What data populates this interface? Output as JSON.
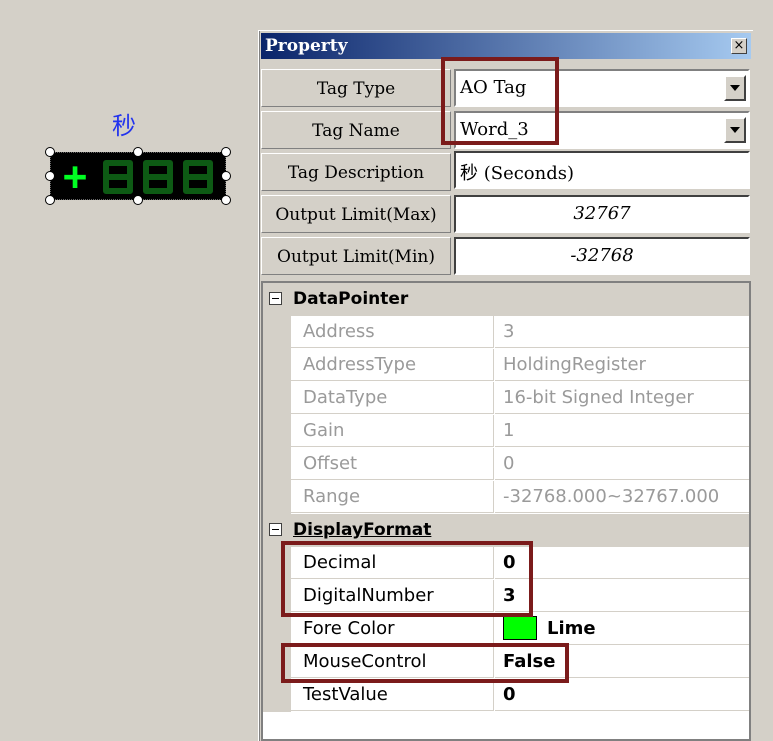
{
  "canvas": {
    "caption": "秒",
    "display": {
      "sign": "+",
      "digit_count": 3,
      "color": "#00ff22",
      "off_color": "#0d5a14"
    }
  },
  "panel": {
    "title": "Property",
    "close_glyph": "×",
    "tag_type": {
      "label": "Tag Type",
      "value": "AO Tag"
    },
    "tag_name": {
      "label": "Tag Name",
      "value": "Word_3"
    },
    "tag_description": {
      "label": "Tag Description",
      "value": "秒 (Seconds)"
    },
    "output_max": {
      "label": "Output Limit(Max)",
      "value": "32767"
    },
    "output_min": {
      "label": "Output Limit(Min)",
      "value": "-32768"
    }
  },
  "grid": {
    "datapointer": {
      "label": "DataPointer",
      "rows": [
        {
          "name": "Address",
          "value": "3"
        },
        {
          "name": "AddressType",
          "value": "HoldingRegister"
        },
        {
          "name": "DataType",
          "value": "16-bit Signed Integer"
        },
        {
          "name": "Gain",
          "value": "1"
        },
        {
          "name": "Offset",
          "value": "0"
        },
        {
          "name": "Range",
          "value": "-32768.000~32767.000"
        }
      ]
    },
    "displayformat": {
      "label": "DisplayFormat",
      "rows": [
        {
          "name": "Decimal",
          "value": "0"
        },
        {
          "name": "DigitalNumber",
          "value": "3"
        },
        {
          "name": "Fore  Color",
          "value": "Lime",
          "swatch": "#00ff00"
        },
        {
          "name": "MouseControl",
          "value": "False"
        },
        {
          "name": "TestValue",
          "value": "0"
        }
      ]
    }
  },
  "colors": {
    "highlight": "#7b1b1b",
    "title_start": "#0a246a",
    "title_end": "#a6caf0"
  }
}
